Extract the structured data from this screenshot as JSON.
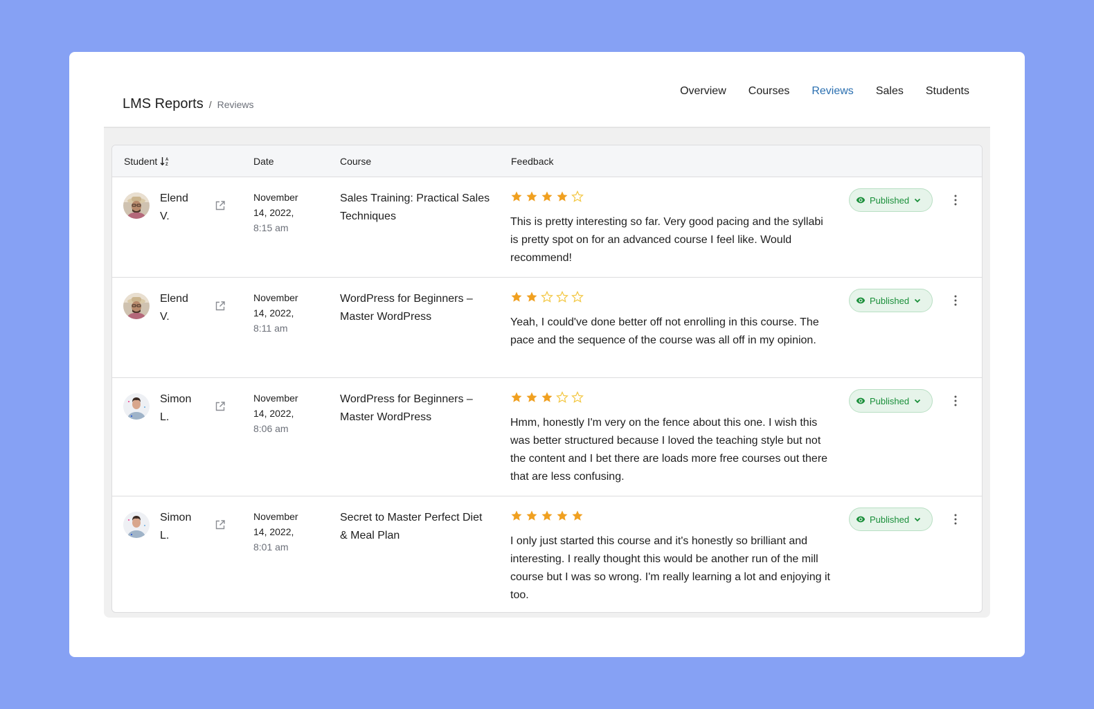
{
  "header": {
    "title": "LMS Reports",
    "separator": "/",
    "breadcrumb": "Reviews"
  },
  "tabs": [
    {
      "label": "Overview",
      "active": false
    },
    {
      "label": "Courses",
      "active": false
    },
    {
      "label": "Reviews",
      "active": true
    },
    {
      "label": "Sales",
      "active": false
    },
    {
      "label": "Students",
      "active": false
    }
  ],
  "table": {
    "columns": {
      "student": "Student",
      "date": "Date",
      "course": "Course",
      "feedback": "Feedback"
    },
    "sort_icon": "sort-alpha-down-icon",
    "rows": [
      {
        "student_first": "Elend",
        "student_last": "V.",
        "avatar": "man-with-hat",
        "date_line1": "November",
        "date_line2": "14, 2022,",
        "time": "8:15 am",
        "course": "Sales Training: Practical Sales Techniques",
        "rating": 4,
        "feedback": "This is pretty interesting so far. Very good pacing and the syllabi is pretty spot on for an advanced course I feel like. Would recommend!",
        "status": "Published"
      },
      {
        "student_first": "Elend",
        "student_last": "V.",
        "avatar": "man-with-hat",
        "date_line1": "November",
        "date_line2": "14, 2022,",
        "time": "8:11 am",
        "course": "WordPress for Beginners – Master WordPress",
        "rating": 2,
        "feedback": "Yeah, I could've done better off not enrolling in this course. The pace and the sequence of the course was all off in my opinion.",
        "status": "Published"
      },
      {
        "student_first": "Simon",
        "student_last": "L.",
        "avatar": "young-man",
        "date_line1": "November",
        "date_line2": "14, 2022,",
        "time": "8:06 am",
        "course": "WordPress for Beginners – Master WordPress",
        "rating": 3,
        "feedback": "Hmm, honestly I'm very on the fence about this one. I wish this was better structured because I loved the teaching style but not the content and I bet there are loads more free courses out there that are less confusing.",
        "status": "Published"
      },
      {
        "student_first": "Simon",
        "student_last": "L.",
        "avatar": "young-man",
        "date_line1": "November",
        "date_line2": "14, 2022,",
        "time": "8:01 am",
        "course": "Secret to Master Perfect Diet & Meal Plan",
        "rating": 5,
        "feedback": "I only just started this course and it's honestly so brilliant and interesting. I really thought this would be another run of the mill course but I was so wrong. I'm really learning a lot and enjoying it too.",
        "status": "Published"
      }
    ],
    "max_rating": 5
  },
  "colors": {
    "page_background": "#86a1f4",
    "accent": "#2a6fb0",
    "star_filled": "#f0a020",
    "star_empty": "#f3c742",
    "status_text": "#1a8f3a",
    "status_background": "#e6f4ea"
  }
}
